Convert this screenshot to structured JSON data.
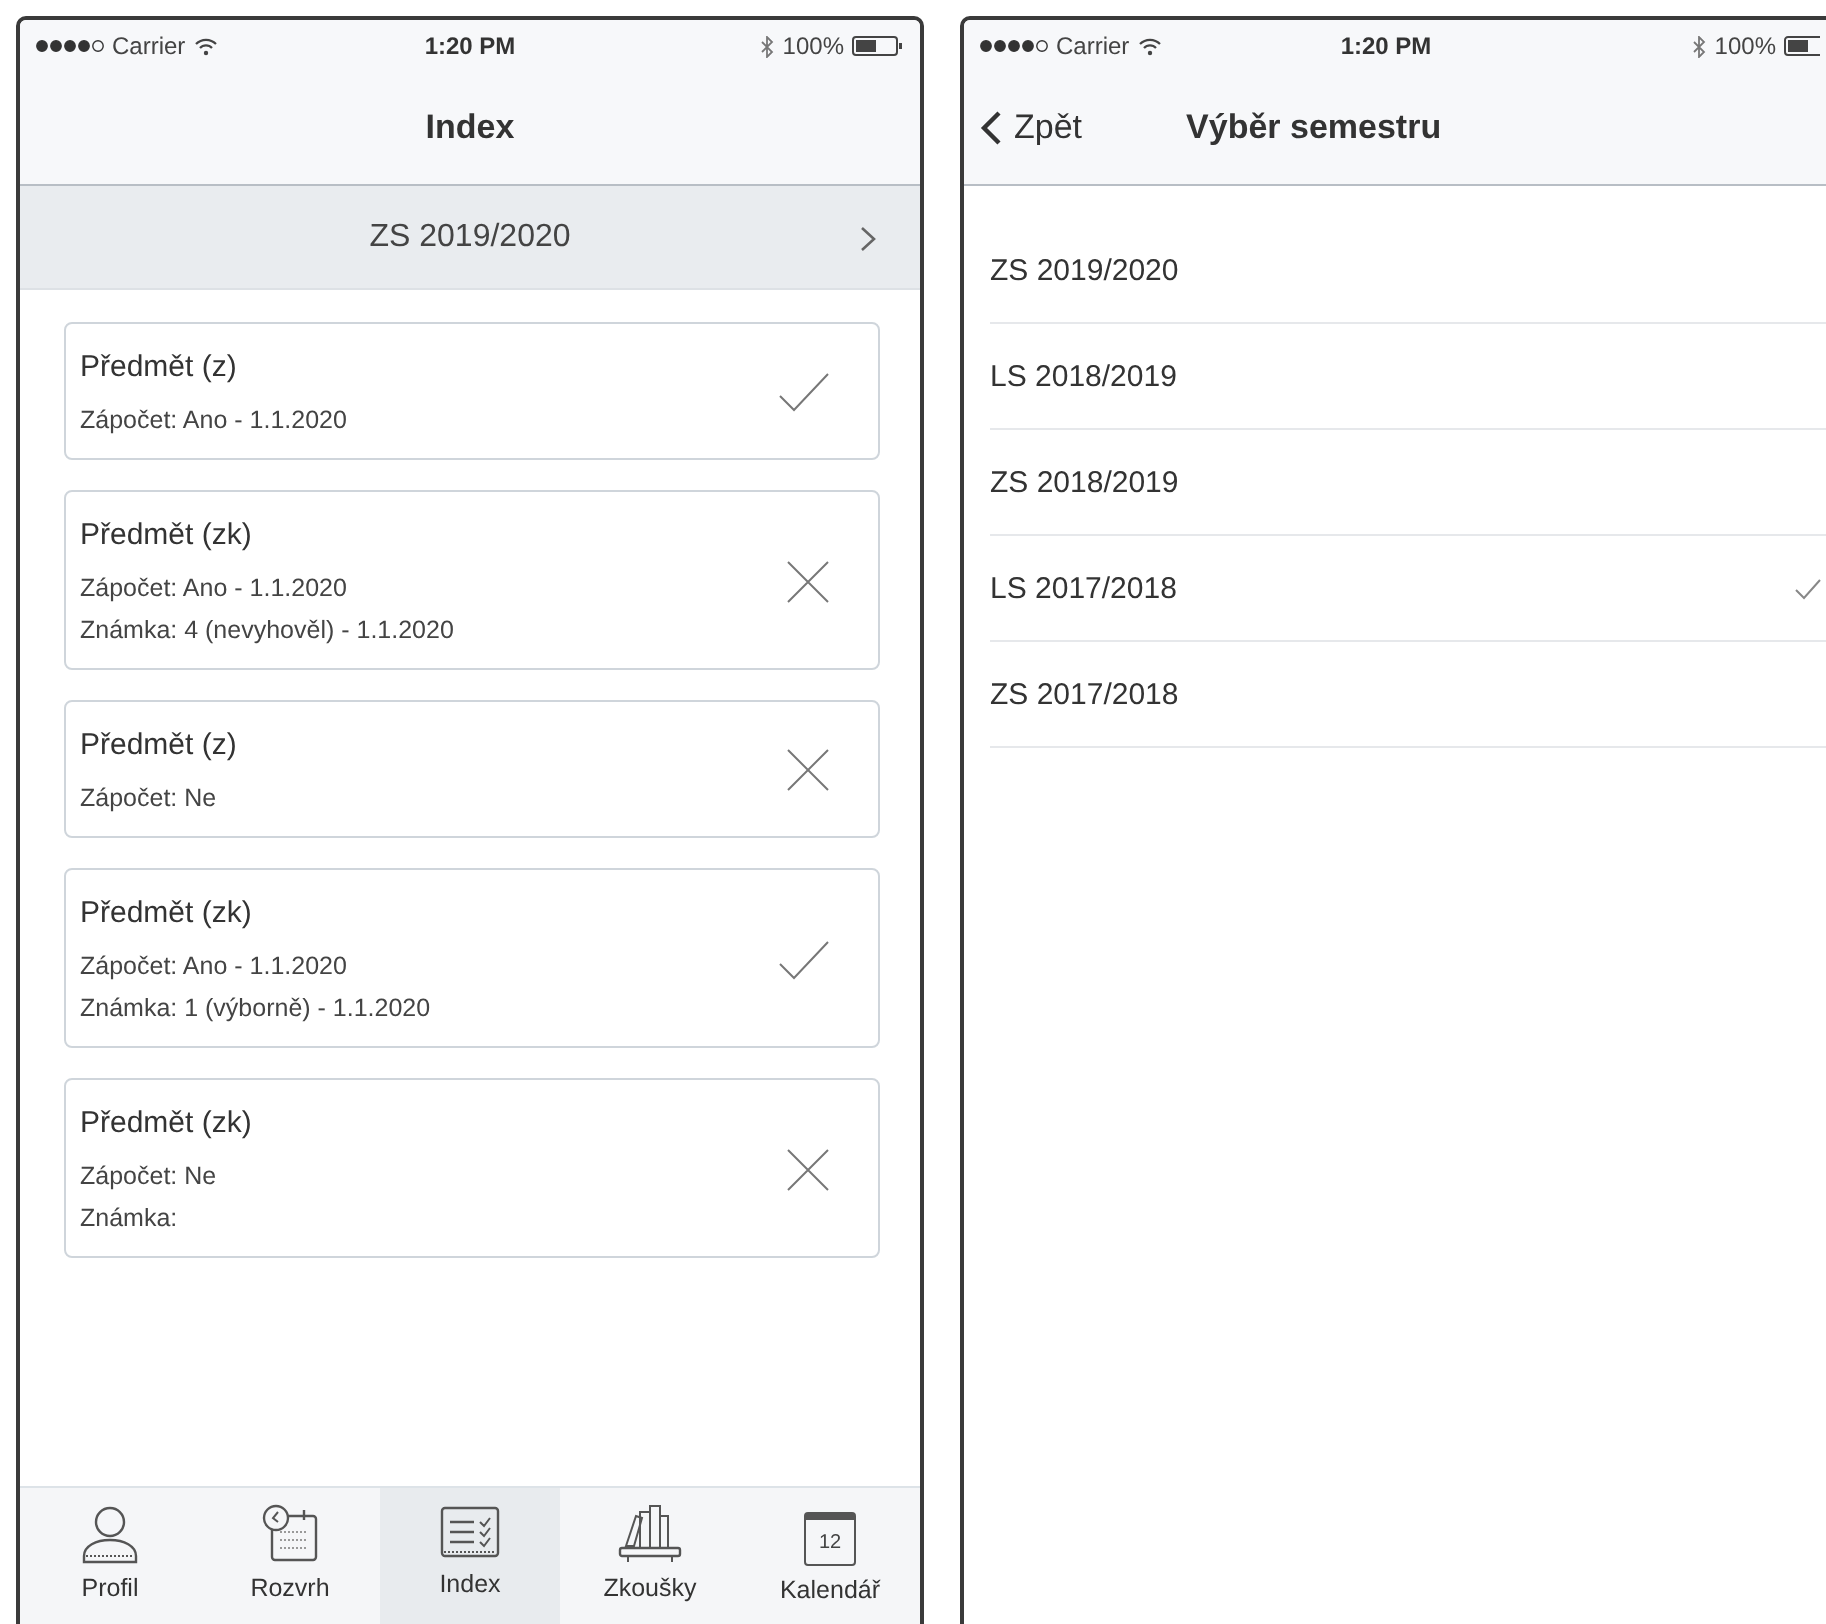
{
  "left_screen": {
    "status_bar": {
      "carrier": "Carrier",
      "time": "1:20 PM",
      "battery": "100%"
    },
    "title": "Index",
    "semester_selector": {
      "label": "ZS 2019/2020"
    },
    "subjects": [
      {
        "title": "Předmět (z)",
        "lines": [
          "Zápočet: Ano - 1.1.2020"
        ],
        "kind": "passed"
      },
      {
        "title": "Předmět (zk)",
        "lines": [
          "Zápočet: Ano - 1.1.2020",
          "Známka: 4 (nevyhověl) - 1.1.2020"
        ],
        "kind": "failed"
      },
      {
        "title": "Předmět (z)",
        "lines": [
          "Zápočet: Ne"
        ],
        "kind": "failed"
      },
      {
        "title": "Předmět (zk)",
        "lines": [
          "Zápočet: Ano - 1.1.2020",
          "Známka: 1 (výborně) - 1.1.2020"
        ],
        "kind": "passed"
      },
      {
        "title": "Předmět (zk)",
        "lines": [
          "Zápočet: Ne",
          "Známka:"
        ],
        "kind": "failed"
      }
    ],
    "tab_bar": [
      {
        "kind": "profile",
        "label": "Profil",
        "selected": false
      },
      {
        "kind": "schedule",
        "label": "Rozvrh",
        "selected": false
      },
      {
        "kind": "index",
        "label": "Index",
        "selected": true
      },
      {
        "kind": "exams",
        "label": "Zkoušky",
        "selected": false
      },
      {
        "kind": "calendar",
        "label": "Kalendář",
        "icon_text": "12",
        "selected": false
      }
    ]
  },
  "right_screen": {
    "status_bar": {
      "carrier": "Carrier",
      "time": "1:20 PM",
      "battery": "100%"
    },
    "back": "Zpět",
    "title": "Výběr semestru",
    "semesters": [
      {
        "label": "ZS 2019/2020",
        "selected": false
      },
      {
        "label": "LS 2018/2019",
        "selected": false
      },
      {
        "label": "ZS 2018/2019",
        "selected": false
      },
      {
        "label": "LS 2017/2018",
        "selected": true
      },
      {
        "label": "ZS 2017/2018",
        "selected": false
      }
    ]
  }
}
